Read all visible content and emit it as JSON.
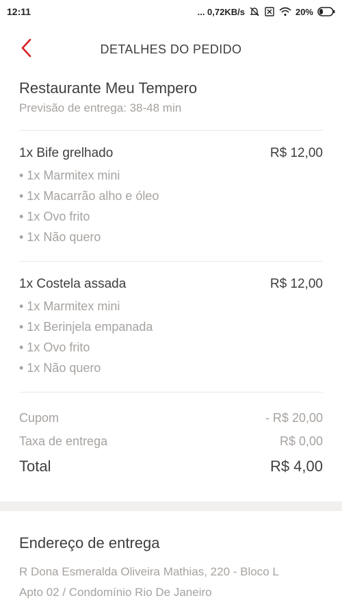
{
  "statusbar": {
    "time": "12:11",
    "network_speed": "... 0,72KB/s",
    "battery": "20%"
  },
  "header": {
    "title": "DETALHES DO PEDIDO",
    "back_icon": "chevron-left-icon",
    "accent_color": "#d71e27"
  },
  "restaurant": {
    "name": "Restaurante Meu Tempero",
    "eta": "Previsão de entrega: 38-48 min"
  },
  "items": [
    {
      "title": "1x Bife grelhado",
      "price": "R$ 12,00",
      "options": [
        "• 1x Marmitex mini",
        "• 1x Macarrão alho e óleo",
        "• 1x Ovo frito",
        "• 1x Não quero"
      ]
    },
    {
      "title": "1x Costela assada",
      "price": "R$ 12,00",
      "options": [
        "• 1x Marmitex mini",
        "• 1x Berinjela empanada",
        "• 1x Ovo frito",
        "• 1x Não quero"
      ]
    }
  ],
  "totals": {
    "coupon_label": "Cupom",
    "coupon_value": "- R$ 20,00",
    "delivery_fee_label": "Taxa de entrega",
    "delivery_fee_value": "R$ 0,00",
    "total_label": "Total",
    "total_value": "R$ 4,00"
  },
  "address": {
    "title": "Endereço de entrega",
    "line1": "R Dona Esmeralda Oliveira Mathias, 220 - Bloco L",
    "line2": "Apto 02 / Condomínio Rio De Janeiro"
  }
}
